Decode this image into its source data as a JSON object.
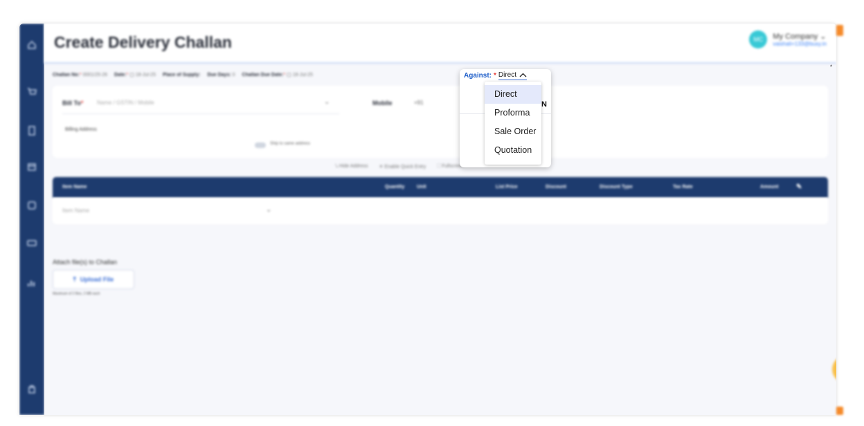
{
  "header": {
    "title": "Create Delivery Challan",
    "company_avatar": "MC",
    "company_name": "My Company",
    "company_email": "vaishali+133@busy.in"
  },
  "meta": {
    "challan_no_label": "Challan No:",
    "challan_no_value": "0001/25-26",
    "date_label": "Date:",
    "date_value": "18-Jul-25",
    "place_of_supply_label": "Place of Supply:",
    "due_days_label": "Due Days:",
    "due_days_value": "0",
    "due_date_label": "Challan Due Date:",
    "due_date_value": "18-Jul-25"
  },
  "bill": {
    "bill_to_label": "Bill To",
    "bill_to_placeholder": "Name / GSTIN / Mobile",
    "mobile_label": "Mobile",
    "mobile_prefix": "+91",
    "billing_address_label": "Billing Address",
    "ship_same_label": "Ship to same address"
  },
  "links": {
    "hide_address": "Hide Address",
    "enable_quick_entry": "Enable Quick Entry",
    "fullscreen": "Fullscreen"
  },
  "items_table": {
    "headers": [
      "Item Name",
      "Quantity",
      "Unit",
      "List Price",
      "Discount",
      "Discount Type",
      "Tax Rate",
      "Amount"
    ],
    "item_placeholder": "Item Name"
  },
  "attach": {
    "title": "Attach file(s) to Challan",
    "upload_label": "Upload File",
    "hint": "Maximum of 2 files, 2 MB each"
  },
  "against": {
    "label": "Against:",
    "required_mark": "*",
    "selected": "Direct",
    "options": [
      "Direct",
      "Proforma",
      "Sale Order",
      "Quotation"
    ],
    "partial_heading_letter": "N"
  },
  "sidebar": {
    "icons": [
      "home-icon",
      "cart-icon",
      "document-icon",
      "box-icon",
      "report-icon",
      "payment-icon",
      "chart-icon",
      "logout-icon"
    ]
  },
  "colors": {
    "sidebar": "#1d3b6e",
    "accent": "#1f5fc9",
    "required": "#e53935",
    "fab": "#f9c04b"
  }
}
